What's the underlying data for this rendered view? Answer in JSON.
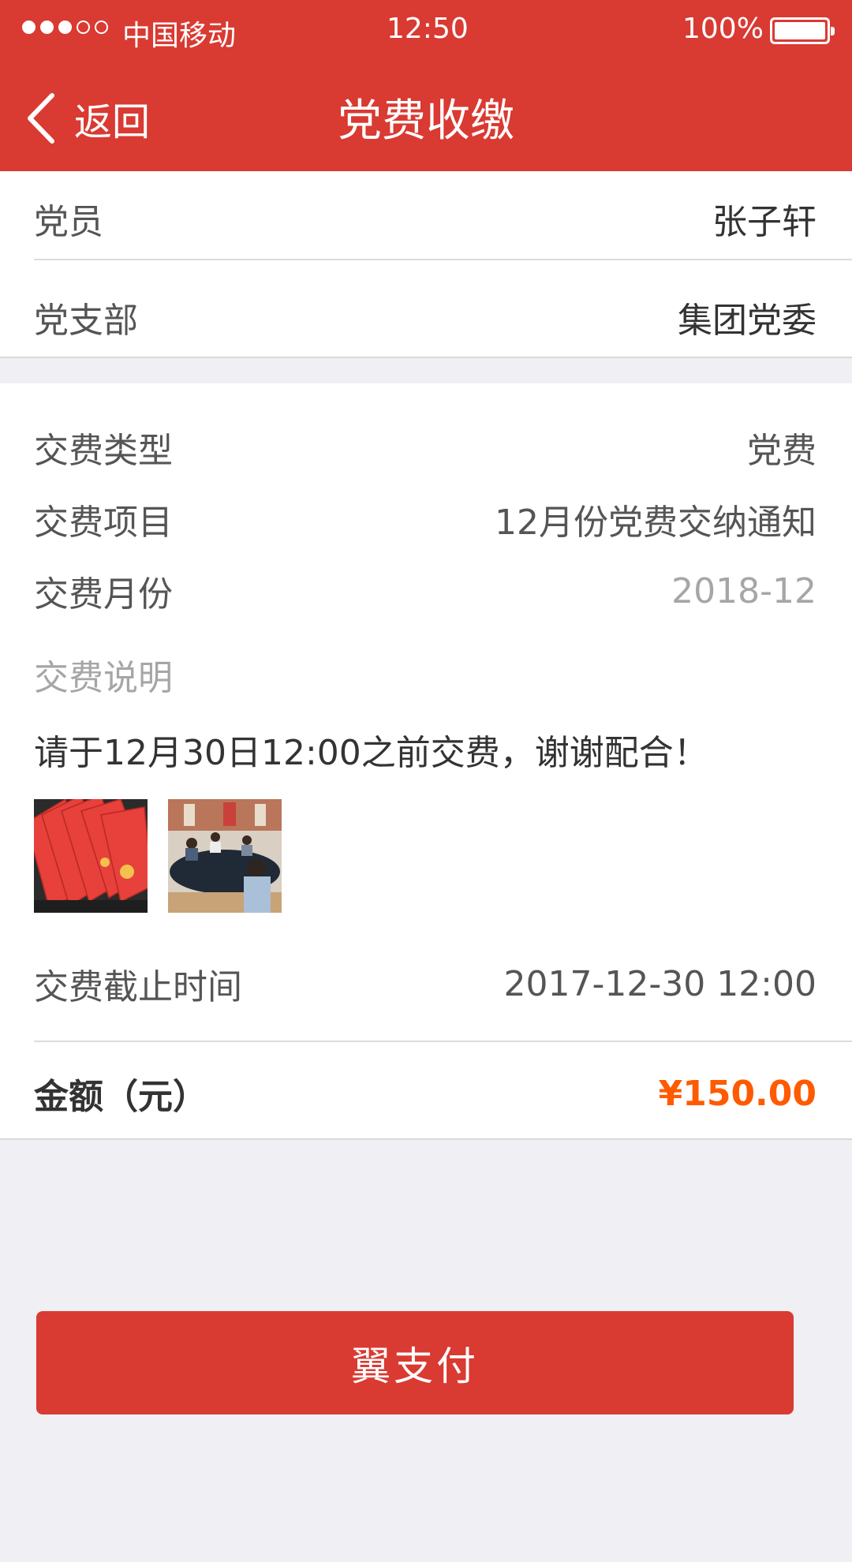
{
  "status_bar": {
    "carrier": "中国移动",
    "time": "12:50",
    "battery": "100%",
    "signal_strength": "3 of 5 bars",
    "battery_level": 1.0
  },
  "nav": {
    "back_label": "返回",
    "title": "党费收缴",
    "back_icon": "chevron-left-icon"
  },
  "member": {
    "label": "党员",
    "value": "张子轩"
  },
  "branch": {
    "label": "党支部",
    "value": "集团党委"
  },
  "fee_type": {
    "label": "交费类型",
    "value": "党费"
  },
  "fee_item": {
    "label": "交费项目",
    "value": "12月份党费交纳通知"
  },
  "fee_month": {
    "label": "交费月份",
    "value": "2018-12"
  },
  "note": {
    "title": "交费说明",
    "text": "请于12月30日12:00之前交费，谢谢配合！",
    "images": [
      "party-membership-cards-photo",
      "meeting-room-photo"
    ]
  },
  "deadline": {
    "label": "交费截止时间",
    "value": "2017-12-30 12:00"
  },
  "amount": {
    "label": "金额（元）",
    "value": "¥150.00"
  },
  "pay_button": {
    "label": "翼支付"
  },
  "colors": {
    "brand_red": "#d93a32",
    "amount_orange": "#ff5a00",
    "background": "#efeff4"
  }
}
